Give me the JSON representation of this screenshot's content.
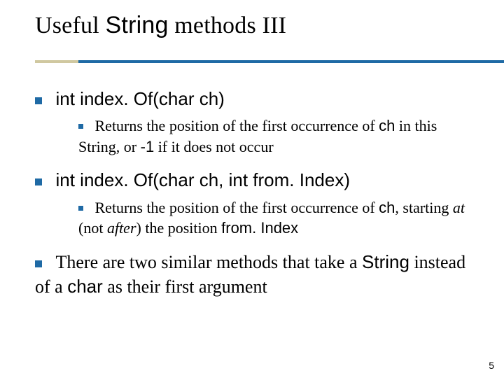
{
  "title": {
    "part1": "Useful ",
    "code": "String",
    "part2": " methods III"
  },
  "bullets": [
    {
      "prefix": "int index. Of(char ch)",
      "sub": {
        "t1": "Returns the position of the first occurrence of ",
        "c1": "ch",
        "t2": " in this String, or ",
        "c2": "-1",
        "t3": " if it does not occur"
      }
    },
    {
      "prefix": "int index. Of(char ch, int from. Index)",
      "sub": {
        "t1": "Returns the position of the first occurrence of ",
        "c1": "ch",
        "t2": ", starting ",
        "i1": "at",
        "t3": " (not ",
        "i2": "after",
        "t4": ") the position ",
        "c2": "from. Index"
      }
    },
    {
      "t1": "There are two similar methods that take a ",
      "c1": "String",
      "t2": " instead of a ",
      "c2": "char",
      "t3": " as their first argument"
    }
  ],
  "page_number": "5",
  "accent": "#1f6aa5"
}
